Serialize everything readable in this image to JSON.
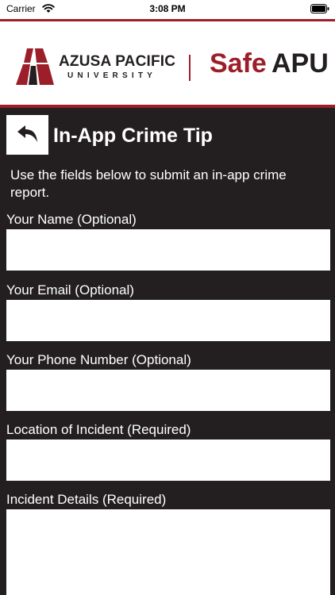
{
  "status_bar": {
    "carrier": "Carrier",
    "time": "3:08 PM",
    "wifi_icon": "wifi-icon",
    "battery_icon": "battery-icon"
  },
  "header": {
    "university_name": "AZUSA PACIFIC",
    "university_subtitle": "UNIVERSITY",
    "app_name_part1": "Safe",
    "app_name_part2": "APU",
    "brand_color": "#9c1e28",
    "logo_icon": "apu-logo-mark"
  },
  "page": {
    "back_icon": "back-arrow-icon",
    "title": "In-App Crime Tip",
    "intro": "Use the fields below to submit an in-app crime report.",
    "background_color": "#231f20"
  },
  "form": {
    "name_label": "Your Name (Optional)",
    "name_value": "",
    "email_label": "Your Email (Optional)",
    "email_value": "",
    "phone_label": "Your Phone Number (Optional)",
    "phone_value": "",
    "location_label": "Location of Incident (Required)",
    "location_value": "",
    "details_label": "Incident Details (Required)",
    "details_value": ""
  }
}
